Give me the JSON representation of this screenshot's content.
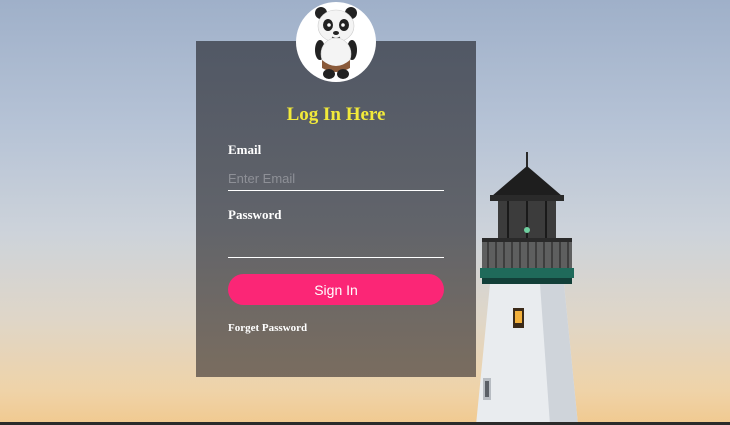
{
  "login": {
    "title": "Log In Here",
    "email_label": "Email",
    "email_placeholder": "Enter Email",
    "email_value": "",
    "password_label": "Password",
    "password_value": "",
    "signin_label": "Sign In",
    "forget_label": "Forget Password"
  },
  "avatar": {
    "icon": "panda-icon"
  },
  "colors": {
    "title": "#f2ea3a",
    "button": "#fb2676",
    "card": "#555a63"
  }
}
